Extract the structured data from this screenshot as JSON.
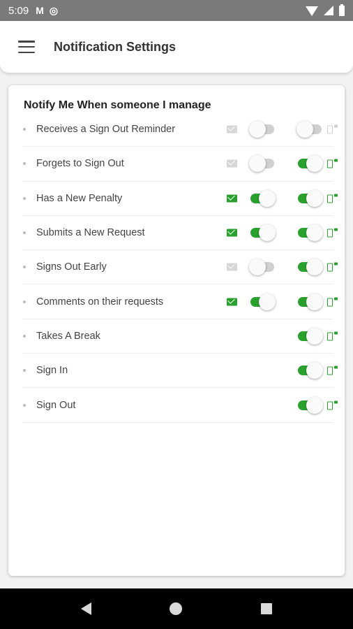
{
  "status_bar": {
    "time": "5:09",
    "icons": [
      "gmail-icon",
      "sync-icon",
      "wifi-icon",
      "signal-icon",
      "battery-icon"
    ]
  },
  "app_bar": {
    "title": "Notification Settings",
    "menu_icon": "hamburger-menu-icon"
  },
  "settings": {
    "heading": "Notify Me When someone I manage",
    "colors": {
      "on": "#2aa12e",
      "off": "#d0d0d0"
    },
    "rows": [
      {
        "label": "Receives a Sign Out Reminder",
        "email_enabled": false,
        "push_enabled": false
      },
      {
        "label": "Forgets to Sign Out",
        "email_enabled": false,
        "push_enabled": true
      },
      {
        "label": "Has a New Penalty",
        "email_enabled": true,
        "push_enabled": true
      },
      {
        "label": "Submits a New Request",
        "email_enabled": true,
        "push_enabled": true
      },
      {
        "label": "Signs Out Early",
        "email_enabled": false,
        "push_enabled": true
      },
      {
        "label": "Comments on their requests",
        "email_enabled": true,
        "push_enabled": true
      },
      {
        "label": "Takes A Break",
        "email_enabled": null,
        "push_enabled": true
      },
      {
        "label": "Sign In",
        "email_enabled": null,
        "push_enabled": true
      },
      {
        "label": "Sign Out",
        "email_enabled": null,
        "push_enabled": true
      }
    ]
  },
  "nav_bar": {
    "icons": [
      "back-icon",
      "home-icon",
      "recents-icon"
    ]
  }
}
